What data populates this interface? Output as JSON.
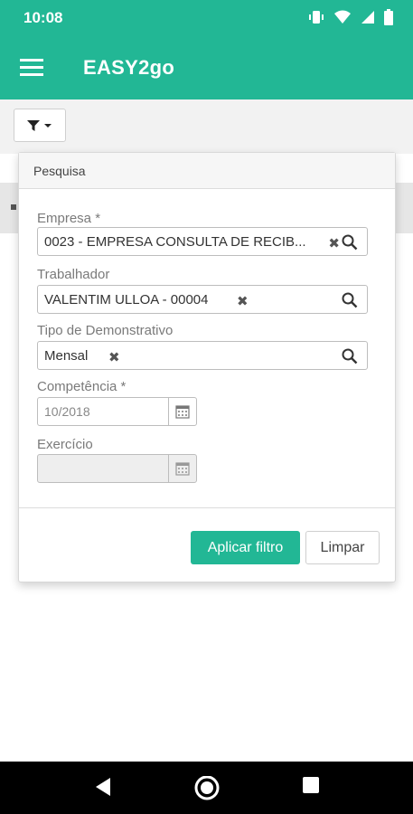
{
  "status_bar": {
    "time": "10:08",
    "icons": [
      "vibrate-icon",
      "wifi-icon",
      "signal-icon",
      "battery-icon"
    ]
  },
  "app_bar": {
    "title": "EASY2go",
    "menu_icon": "hamburger-menu-icon"
  },
  "toolbar": {
    "filter_icon": "filter-funnel-icon"
  },
  "filter_panel": {
    "header": "Pesquisa",
    "empresa": {
      "label": "Empresa *",
      "value": "0023 - EMPRESA CONSULTA DE RECIB..."
    },
    "trabalhador": {
      "label": "Trabalhador",
      "value": "VALENTIM ULLOA - 00004"
    },
    "tipo": {
      "label": "Tipo de Demonstrativo",
      "value": "Mensal"
    },
    "competencia": {
      "label": "Competência *",
      "value": "10/2018"
    },
    "exercicio": {
      "label": "Exercício",
      "value": ""
    },
    "apply_label": "Aplicar filtro",
    "clear_label": "Limpar"
  },
  "colors": {
    "brand": "#22b795",
    "panel_border": "#d8d8d8",
    "nav_bar": "#000000"
  },
  "nav_bar": {
    "icons": [
      "back-icon",
      "home-icon",
      "recents-icon"
    ]
  }
}
